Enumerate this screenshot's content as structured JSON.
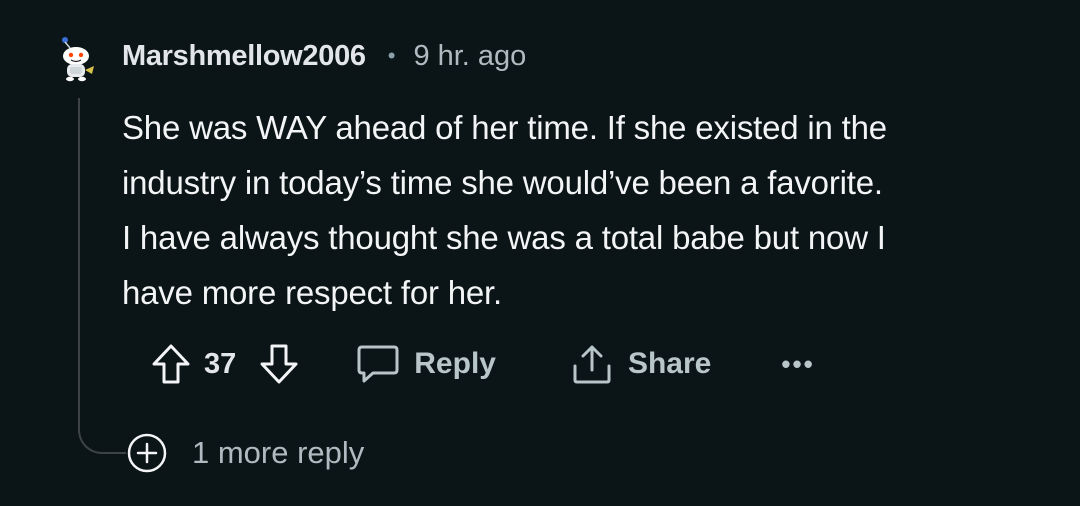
{
  "comment": {
    "author": "Marshmellow2006",
    "separator": "•",
    "time": "9 hr. ago",
    "body": "She was WAY ahead of her time. If she existed in the\nindustry in today’s time she would’ve been a favorite.\nI have always thought she was a total babe but now I\nhave more respect for her.",
    "score": "37",
    "reply_label": "Reply",
    "share_label": "Share",
    "more_label": "•••"
  },
  "more_replies": {
    "label": "1 more reply"
  },
  "icons": {
    "upvote": "upvote-arrow-icon",
    "downvote": "downvote-arrow-icon",
    "reply": "speech-bubble-icon",
    "share": "share-upload-icon",
    "expand": "plus-circle-icon",
    "avatar": "snoo-avatar-icon"
  },
  "colors": {
    "background": "#0b1416",
    "text": "#f2f4f5",
    "muted": "#b0bac0",
    "thread_line": "#3e4446"
  }
}
